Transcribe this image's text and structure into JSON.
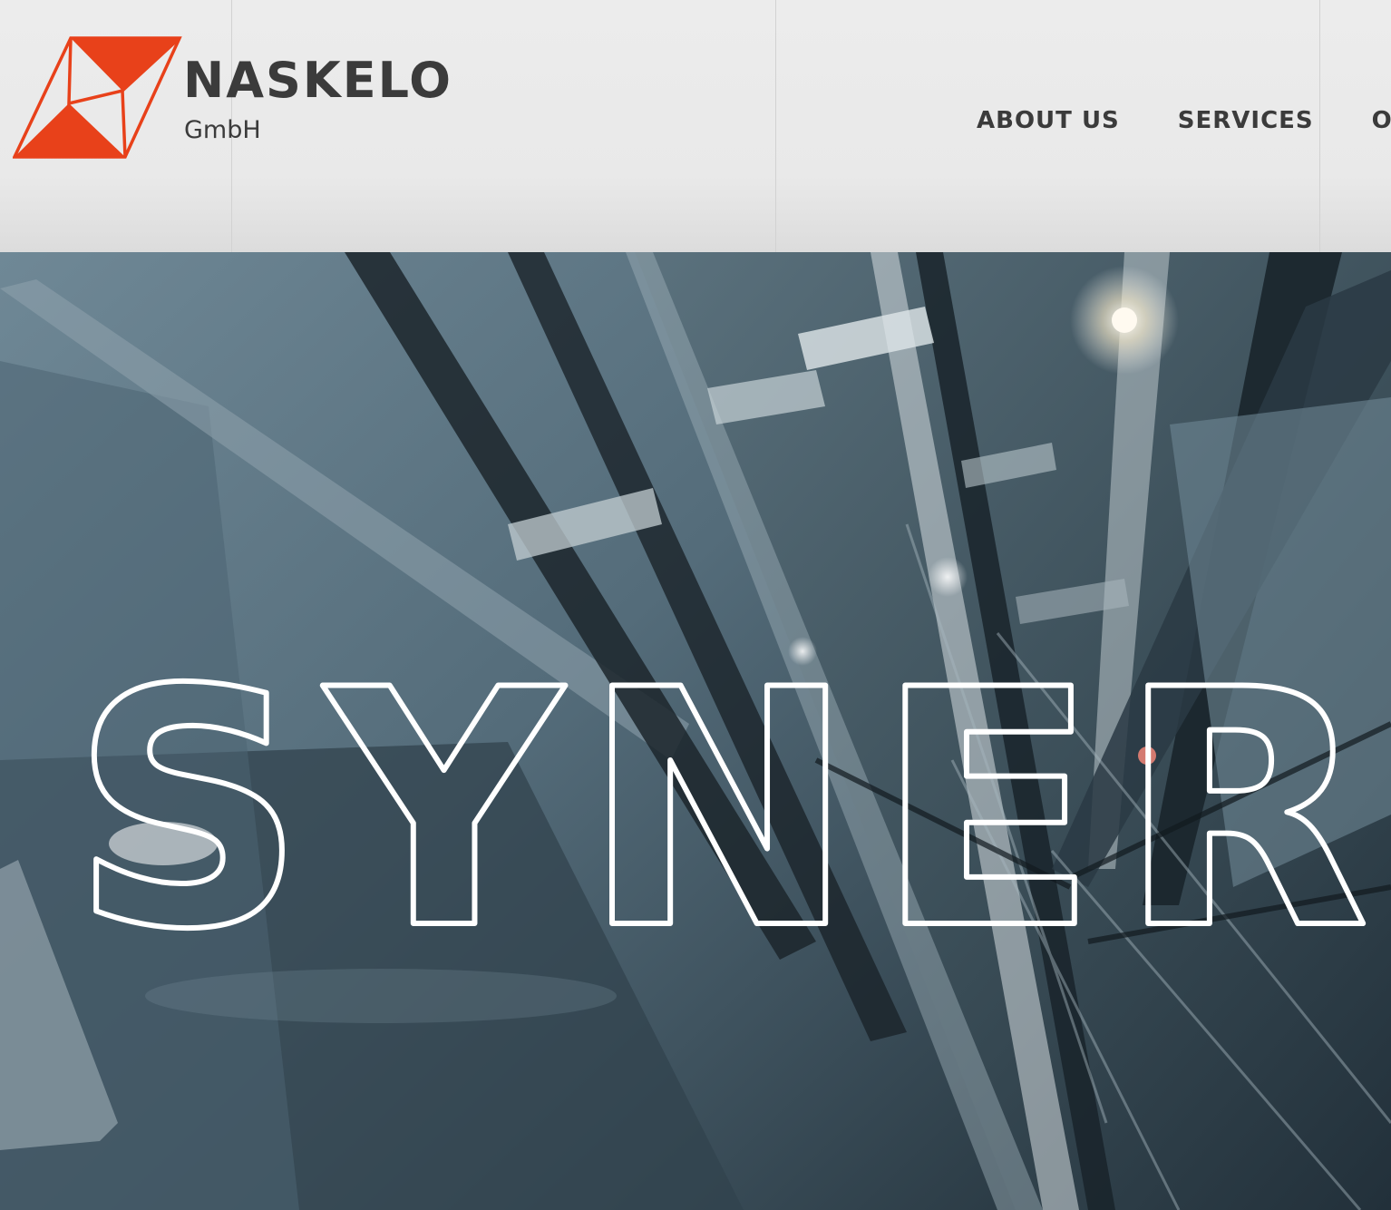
{
  "brand": {
    "name": "NASKELO",
    "suffix": "GmbH",
    "colors": {
      "logo_orange": "#e8411a",
      "text_dark": "#3b3b3b",
      "header_bg": "#e9e9e9"
    }
  },
  "nav": {
    "items": [
      {
        "label": "ABOUT US"
      },
      {
        "label": "SERVICES"
      },
      {
        "label": "OU"
      }
    ]
  },
  "hero": {
    "headline": "SYNERG",
    "image_subject": "elevator shaft viewed from below",
    "outline_color": "#ffffff"
  }
}
